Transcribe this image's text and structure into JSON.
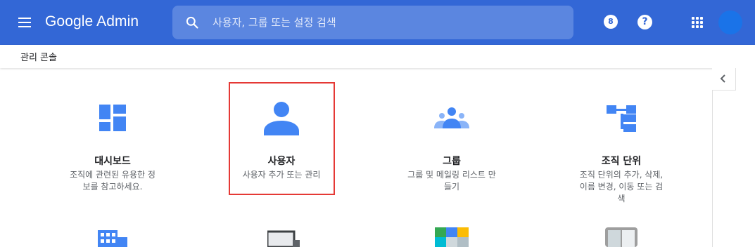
{
  "app": {
    "brand": "Google Admin"
  },
  "search": {
    "placeholder": "사용자, 그룹 또는 설정 검색"
  },
  "header": {
    "notification_badge": "8",
    "help_label": "?"
  },
  "breadcrumb": {
    "label": "관리 콘솔"
  },
  "cards": [
    {
      "title": "대시보드",
      "desc": "조직에 관련된 유용한 정보를 참고하세요."
    },
    {
      "title": "사용자",
      "desc": "사용자 추가 또는 관리"
    },
    {
      "title": "그룹",
      "desc": "그룹 및 메일링 리스트 만들기"
    },
    {
      "title": "조직 단위",
      "desc": "조직 단위의 추가, 삭제, 이름 변경, 이동 또는 검색"
    }
  ],
  "colors": {
    "topbar": "#3367d6",
    "accent_icon": "#4285f4",
    "selection": "#e53935"
  },
  "icons": [
    "menu-icon",
    "search-icon",
    "notifications-icon",
    "help-icon",
    "apps-icon",
    "avatar",
    "chevron-left-icon",
    "dashboard-icon",
    "user-icon",
    "group-icon",
    "org-unit-icon",
    "building-icon",
    "device-icon",
    "apps-tile-icon",
    "security-icon"
  ]
}
